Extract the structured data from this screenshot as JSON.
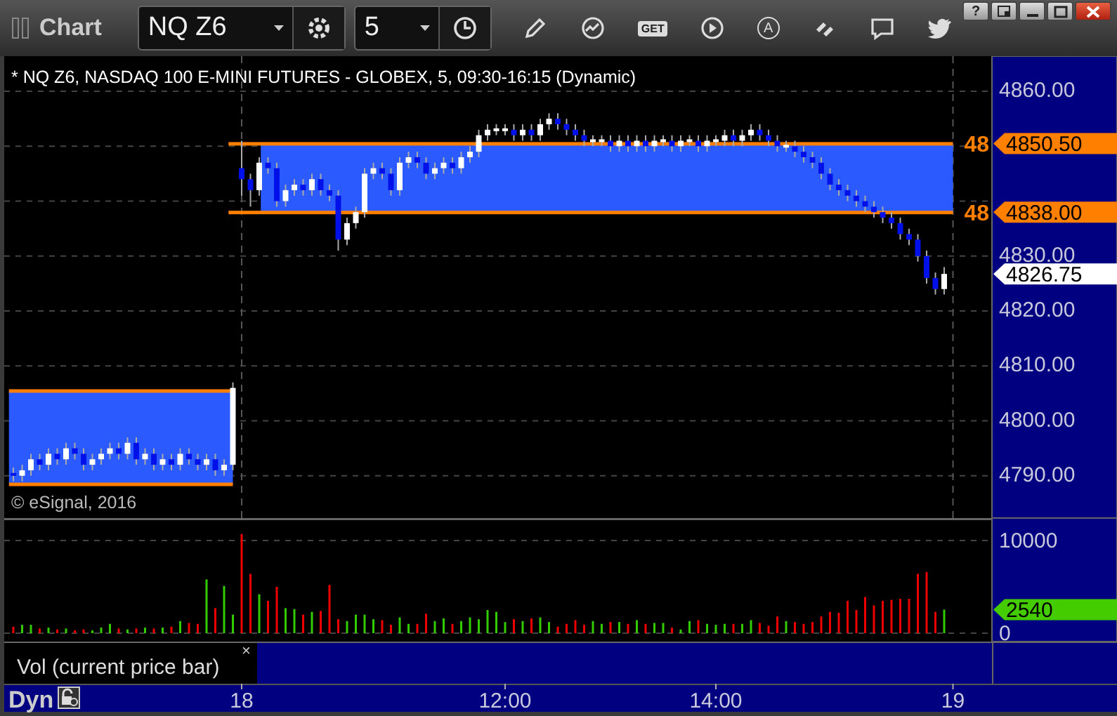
{
  "toolbar": {
    "title": "Chart",
    "symbol": {
      "value": "NQ Z6"
    },
    "interval": {
      "value": "5"
    },
    "tools": [
      {
        "kind": "pencil"
      },
      {
        "kind": "study"
      },
      {
        "kind": "get",
        "label": "GET"
      },
      {
        "kind": "play"
      },
      {
        "kind": "alert",
        "label": "A"
      },
      {
        "kind": "link"
      },
      {
        "kind": "comment"
      },
      {
        "kind": "bird"
      }
    ],
    "window_buttons": [
      {
        "kind": "help",
        "label": "?"
      },
      {
        "kind": "dock"
      },
      {
        "kind": "minimize"
      },
      {
        "kind": "maximize"
      },
      {
        "kind": "close"
      }
    ]
  },
  "price_panel": {
    "header": "* NQ Z6, NASDAQ 100 E-MINI FUTURES - GLOBEX, 5, 09:30-16:15 (Dynamic)",
    "copyright": "© eSignal, 2016",
    "chart_data": {
      "type": "candlestick",
      "grid": true,
      "ylim": [
        4782.3,
        4866.4
      ],
      "yticks": [
        {
          "value": 4790,
          "label": "4790.00"
        },
        {
          "value": 4800,
          "label": "4800.00"
        },
        {
          "value": 4810,
          "label": "4810.00"
        },
        {
          "value": 4820,
          "label": "4820.00"
        },
        {
          "value": 4830,
          "label": "4830.00"
        },
        {
          "value": 4860,
          "label": "4860.00"
        }
      ],
      "categories": [
        null,
        null,
        null,
        null,
        null,
        null,
        null,
        null,
        null,
        null,
        null,
        null,
        null,
        null,
        null,
        null,
        null,
        null,
        null,
        null,
        null,
        null,
        null,
        null,
        null,
        null,
        null,
        null,
        null,
        null,
        null,
        null,
        null,
        null,
        null,
        null,
        null,
        null,
        null,
        null,
        null,
        null,
        null,
        null,
        null,
        null,
        null,
        null,
        null,
        null,
        null,
        null,
        null,
        null,
        null,
        null,
        null,
        null,
        null,
        null,
        null,
        null,
        null,
        null,
        null,
        null,
        null,
        null,
        null,
        null,
        null,
        null,
        null,
        null,
        null,
        null,
        null,
        null,
        null,
        null,
        null,
        null,
        null,
        null,
        null,
        null,
        null,
        null,
        null,
        null,
        null,
        null,
        null,
        null,
        null,
        null,
        null,
        null,
        null,
        null,
        null,
        null,
        null,
        null,
        null,
        null,
        null,
        null
      ],
      "ohlc": [
        [
          4790.5,
          4791.5,
          4789,
          4790
        ],
        [
          4790,
          4792,
          4789,
          4791
        ],
        [
          4791,
          4794,
          4790,
          4793
        ],
        [
          4793,
          4794,
          4791,
          4792
        ],
        [
          4792,
          4795,
          4791,
          4794
        ],
        [
          4794,
          4795,
          4792,
          4793
        ],
        [
          4793,
          4796,
          4792,
          4795
        ],
        [
          4795,
          4796,
          4793,
          4794
        ],
        [
          4794,
          4795,
          4791,
          4792
        ],
        [
          4792,
          4794,
          4791,
          4793
        ],
        [
          4793,
          4795,
          4792,
          4794
        ],
        [
          4794,
          4796,
          4793,
          4795
        ],
        [
          4795,
          4796,
          4793,
          4794
        ],
        [
          4794,
          4797,
          4793,
          4796
        ],
        [
          4796,
          4797,
          4792,
          4793
        ],
        [
          4793,
          4795,
          4792,
          4794
        ],
        [
          4794,
          4795,
          4791,
          4792
        ],
        [
          4792,
          4794,
          4791,
          4793
        ],
        [
          4793,
          4794,
          4791,
          4792
        ],
        [
          4792,
          4795,
          4791,
          4794
        ],
        [
          4794,
          4795,
          4792,
          4793
        ],
        [
          4793,
          4794,
          4791,
          4792
        ],
        [
          4792,
          4794,
          4791,
          4793
        ],
        [
          4793,
          4794,
          4790,
          4791
        ],
        [
          4791,
          4793,
          4790,
          4792
        ],
        [
          4792,
          4807,
          4791,
          4806
        ],
        [
          4846,
          4851,
          4841,
          4844
        ],
        [
          4844,
          4845,
          4839,
          4842
        ],
        [
          4842,
          4848,
          4841,
          4847
        ],
        [
          4847,
          4848,
          4845,
          4846
        ],
        [
          4846,
          4847,
          4839,
          4840
        ],
        [
          4840,
          4843,
          4839,
          4842
        ],
        [
          4842,
          4844,
          4841,
          4843
        ],
        [
          4843,
          4844,
          4841,
          4842
        ],
        [
          4842,
          4845,
          4841,
          4844
        ],
        [
          4844,
          4845,
          4841,
          4842
        ],
        [
          4842,
          4843,
          4840,
          4841
        ],
        [
          4841,
          4842,
          4831,
          4833
        ],
        [
          4833,
          4837,
          4832,
          4836
        ],
        [
          4836,
          4839,
          4835,
          4838
        ],
        [
          4838,
          4846,
          4837,
          4845
        ],
        [
          4845,
          4847,
          4844,
          4846
        ],
        [
          4846,
          4847,
          4844,
          4845
        ],
        [
          4845,
          4846,
          4841,
          4842
        ],
        [
          4842,
          4848,
          4841,
          4847
        ],
        [
          4847,
          4849,
          4846,
          4848
        ],
        [
          4848,
          4849,
          4846,
          4847
        ],
        [
          4847,
          4848,
          4844,
          4845
        ],
        [
          4845,
          4847,
          4844,
          4846
        ],
        [
          4846,
          4848,
          4845,
          4847
        ],
        [
          4847,
          4848,
          4845,
          4846
        ],
        [
          4846,
          4849,
          4845,
          4848
        ],
        [
          4848,
          4850,
          4847,
          4849
        ],
        [
          4849,
          4853,
          4848,
          4852
        ],
        [
          4852,
          4854,
          4851,
          4853
        ],
        [
          4853,
          4854,
          4852,
          4853
        ],
        [
          4853,
          4854,
          4852,
          4853
        ],
        [
          4853,
          4854,
          4851,
          4852
        ],
        [
          4852,
          4854,
          4851,
          4853
        ],
        [
          4853,
          4854,
          4851,
          4852
        ],
        [
          4852,
          4855,
          4851,
          4854
        ],
        [
          4854,
          4856,
          4853,
          4855
        ],
        [
          4855,
          4856,
          4853,
          4854
        ],
        [
          4854,
          4855,
          4852,
          4853
        ],
        [
          4853,
          4854,
          4851,
          4852
        ],
        [
          4852,
          4853,
          4850,
          4851
        ],
        [
          4851,
          4852,
          4850,
          4851
        ],
        [
          4851,
          4852,
          4850,
          4851
        ],
        [
          4851,
          4852,
          4849,
          4850
        ],
        [
          4850,
          4852,
          4849,
          4851
        ],
        [
          4851,
          4852,
          4849,
          4850
        ],
        [
          4850,
          4852,
          4849,
          4851
        ],
        [
          4851,
          4852,
          4849,
          4850
        ],
        [
          4850,
          4852,
          4849,
          4851
        ],
        [
          4851,
          4852,
          4850,
          4851
        ],
        [
          4851,
          4852,
          4849,
          4850
        ],
        [
          4850,
          4852,
          4849,
          4851
        ],
        [
          4851,
          4852,
          4850,
          4851
        ],
        [
          4851,
          4852,
          4849,
          4850
        ],
        [
          4850,
          4852,
          4849,
          4851
        ],
        [
          4851,
          4852,
          4850,
          4851
        ],
        [
          4851,
          4853,
          4850,
          4852
        ],
        [
          4852,
          4853,
          4850,
          4851
        ],
        [
          4851,
          4853,
          4850,
          4852
        ],
        [
          4852,
          4854,
          4851,
          4853
        ],
        [
          4853,
          4854,
          4851,
          4852
        ],
        [
          4852,
          4853,
          4850,
          4851
        ],
        [
          4851,
          4852,
          4849,
          4850
        ],
        [
          4850,
          4851,
          4849,
          4850
        ],
        [
          4850,
          4851,
          4848,
          4849
        ],
        [
          4849,
          4850,
          4847,
          4848
        ],
        [
          4848,
          4849,
          4846,
          4847
        ],
        [
          4847,
          4848,
          4844,
          4845
        ],
        [
          4845,
          4846,
          4842,
          4843
        ],
        [
          4843,
          4844,
          4841,
          4842
        ],
        [
          4842,
          4843,
          4840,
          4841
        ],
        [
          4841,
          4842,
          4839,
          4840
        ],
        [
          4840,
          4841,
          4838,
          4839
        ],
        [
          4839,
          4840,
          4837,
          4838
        ],
        [
          4838,
          4839,
          4836,
          4837
        ],
        [
          4837,
          4838,
          4835,
          4836
        ],
        [
          4836,
          4837,
          4833,
          4834
        ],
        [
          4834,
          4835,
          4832,
          4833
        ],
        [
          4833,
          4834,
          4829,
          4830
        ],
        [
          4830,
          4831,
          4825,
          4826
        ],
        [
          4826,
          4827,
          4823,
          4824
        ],
        [
          4824,
          4828,
          4823,
          4826.75
        ],
        null
      ],
      "bands": [
        {
          "axis": "y",
          "from": 4838,
          "to": 4850.5,
          "color": "#2b5bff"
        },
        {
          "axis": "y",
          "from": 4788.5,
          "to": 4805.5,
          "color": "#2b5bff"
        }
      ],
      "ref_lines": [
        {
          "axis": "y",
          "value": 4850.5,
          "color": "#ff8000",
          "label": "4850.50"
        },
        {
          "axis": "y",
          "value": 4838,
          "color": "#ff8000",
          "label": "4838.00"
        },
        {
          "axis": "y",
          "value": 4805.5,
          "color": "#ff8000"
        },
        {
          "axis": "y",
          "value": 4788.5,
          "color": "#ff8000"
        }
      ],
      "annotations": [
        "48",
        "48",
        "4826.75"
      ]
    }
  },
  "volume_panel": {
    "chart_data": {
      "type": "bar",
      "grid": true,
      "categories": [
        null,
        null,
        null,
        null,
        null,
        null,
        null,
        null,
        null,
        null,
        null,
        null,
        null,
        null,
        null,
        null,
        null,
        null,
        null,
        null,
        null,
        null,
        null,
        null,
        null,
        null,
        "18",
        null,
        null,
        null,
        null,
        null,
        null,
        null,
        null,
        null,
        null,
        null,
        null,
        null,
        null,
        null,
        null,
        null,
        null,
        null,
        null,
        null,
        null,
        null,
        null,
        null,
        null,
        null,
        null,
        null,
        "12:00",
        null,
        null,
        null,
        null,
        null,
        null,
        null,
        null,
        null,
        null,
        null,
        null,
        null,
        null,
        null,
        null,
        null,
        null,
        null,
        null,
        null,
        null,
        null,
        "14:00",
        null,
        null,
        null,
        null,
        null,
        null,
        null,
        null,
        null,
        null,
        null,
        null,
        null,
        null,
        null,
        null,
        null,
        null,
        null,
        null,
        null,
        null,
        null,
        null,
        null,
        null,
        "19"
      ],
      "ylim": [
        0,
        12424
      ],
      "yticks": [
        {
          "value": 0,
          "label": "0"
        },
        {
          "value": 10000,
          "label": "10000"
        }
      ],
      "series": [
        {
          "color": "#33cc00",
          "values": [
            null,
            900,
            900,
            null,
            600,
            null,
            500,
            null,
            null,
            300,
            600,
            1000,
            null,
            400,
            null,
            600,
            null,
            600,
            null,
            1300,
            null,
            null,
            5800,
            null,
            5100,
            2000,
            null,
            null,
            4200,
            null,
            null,
            2700,
            2600,
            null,
            2300,
            null,
            null,
            null,
            1300,
            2000,
            2000,
            1500,
            null,
            null,
            1700,
            1000,
            null,
            null,
            1300,
            1600,
            null,
            1300,
            1700,
            1500,
            2500,
            2300,
            1200,
            null,
            1300,
            null,
            1700,
            1200,
            null,
            null,
            null,
            null,
            1300,
            1000,
            null,
            1200,
            null,
            1400,
            null,
            1100,
            1100,
            null,
            400,
            1300,
            null,
            1000,
            900,
            1000,
            null,
            1000,
            1400,
            null,
            null,
            null,
            1300,
            null,
            null,
            null,
            null,
            null,
            null,
            null,
            null,
            null,
            null,
            null,
            null,
            null,
            null,
            null,
            null,
            null,
            2540,
            null
          ]
        },
        {
          "color": "#ee0000",
          "values": [
            700,
            null,
            null,
            500,
            null,
            400,
            null,
            300,
            400,
            null,
            null,
            null,
            500,
            null,
            500,
            null,
            500,
            null,
            700,
            null,
            1100,
            1000,
            null,
            2700,
            null,
            null,
            10700,
            6400,
            null,
            3500,
            5000,
            null,
            null,
            2000,
            null,
            2400,
            5200,
            1500,
            null,
            null,
            null,
            null,
            1400,
            900,
            null,
            null,
            1000,
            2100,
            null,
            null,
            1000,
            null,
            null,
            null,
            null,
            null,
            null,
            1500,
            null,
            1600,
            null,
            null,
            700,
            1000,
            1400,
            900,
            null,
            null,
            1200,
            null,
            1000,
            null,
            1000,
            null,
            null,
            600,
            null,
            null,
            1400,
            null,
            null,
            null,
            1000,
            null,
            null,
            1100,
            800,
            1800,
            null,
            1200,
            1000,
            1200,
            1800,
            2300,
            2200,
            3500,
            2500,
            3900,
            3000,
            3500,
            3600,
            3700,
            3700,
            6400,
            6600,
            2300,
            null,
            null
          ]
        }
      ],
      "annotations": [
        "2540"
      ]
    },
    "legend": {
      "label": "Vol (current price bar)",
      "close": "×"
    }
  },
  "footer": {
    "mode": "Dyn"
  }
}
